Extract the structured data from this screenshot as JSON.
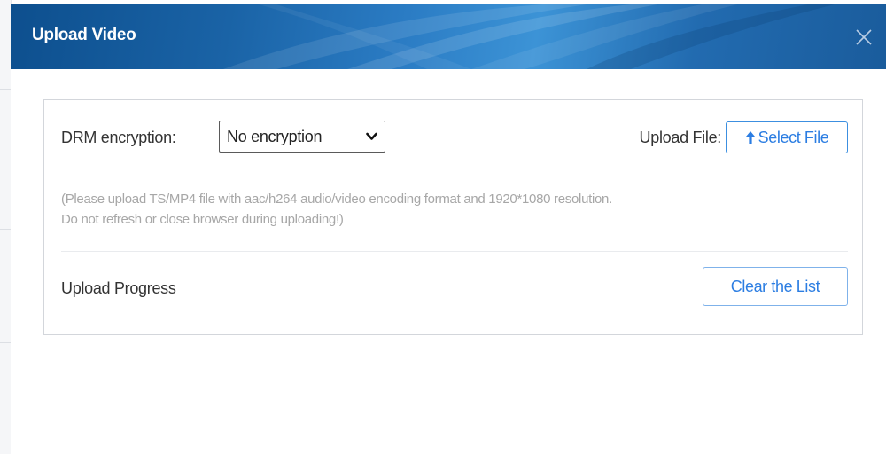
{
  "dialog": {
    "title": "Upload Video",
    "close_icon": "close-icon"
  },
  "form": {
    "drm_label": "DRM encryption:",
    "drm_selected": "No encryption",
    "upload_file_label": "Upload File:",
    "select_file_label": "Select File",
    "select_file_icon": "arrow-up-icon",
    "hint_line1": "(Please upload TS/MP4 file with aac/h264 audio/video encoding format and 1920*1080 resolution.",
    "hint_line2": "Do not refresh or close browser during uploading!)",
    "progress_label": "Upload Progress",
    "clear_list_label": "Clear the List"
  },
  "colors": {
    "header": "#1a63a6",
    "accent": "#2b7de2",
    "hint_text": "#a7a7a7"
  }
}
